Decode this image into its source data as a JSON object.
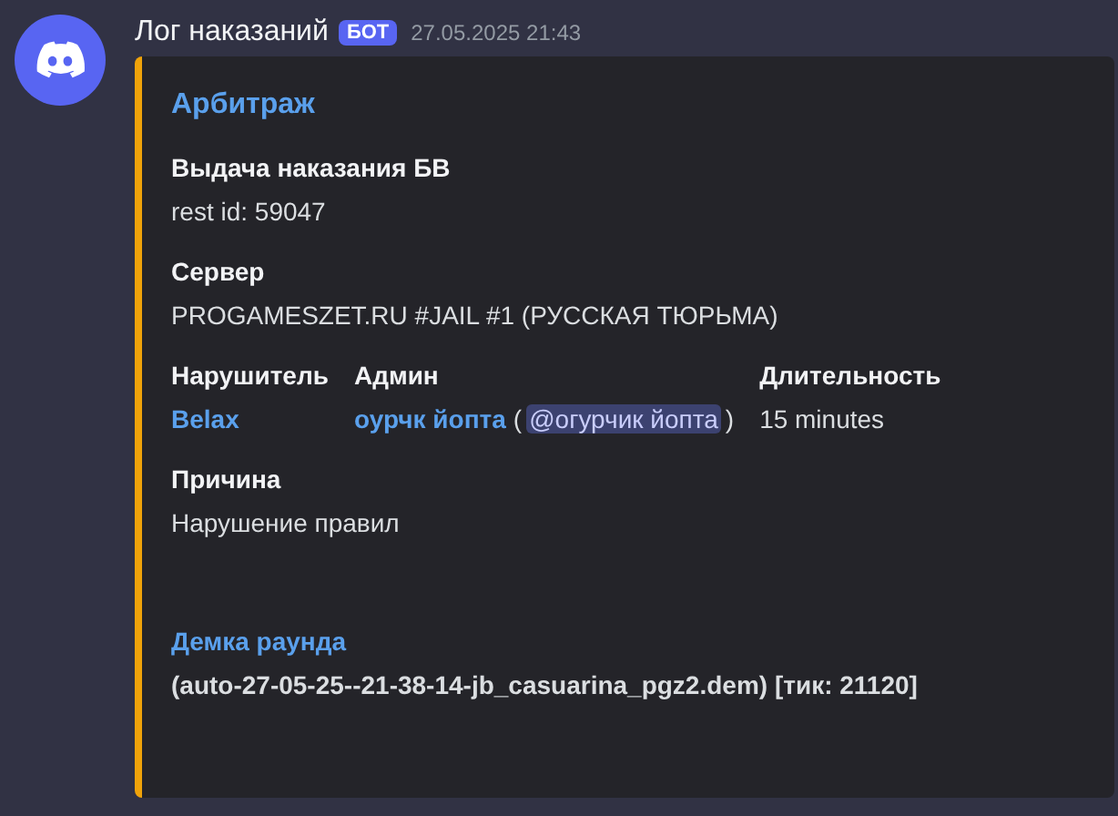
{
  "message": {
    "author": "Лог наказаний",
    "badge": "БОТ",
    "timestamp": "27.05.2025 21:43"
  },
  "embed": {
    "title": "Арбитраж",
    "fields": [
      {
        "name": "Выдача наказания БВ",
        "inline": false,
        "kind": "plain",
        "value": [
          {
            "kind": "text",
            "text": "rest id: 59047"
          }
        ]
      },
      {
        "name": "Сервер",
        "inline": false,
        "kind": "plain",
        "value": [
          {
            "kind": "text",
            "text": "PROGAMESZET.RU #JAIL #1 (РУССКАЯ ТЮРЬМА)"
          }
        ]
      },
      {
        "name": "Нарушитель",
        "inline": true,
        "kind": "plain",
        "value": [
          {
            "kind": "link",
            "text": "Belax"
          }
        ]
      },
      {
        "name": "Админ",
        "inline": true,
        "kind": "plain",
        "value": [
          {
            "kind": "link",
            "text": "оурчк йопта"
          },
          {
            "kind": "text",
            "text": "("
          },
          {
            "kind": "mention",
            "text": "@огурчик йопта"
          },
          {
            "kind": "text",
            "text": ")"
          }
        ]
      },
      {
        "name": "Длительность",
        "inline": true,
        "kind": "plain",
        "value": [
          {
            "kind": "text",
            "text": "15 minutes"
          }
        ]
      },
      {
        "name": "Причина",
        "inline": false,
        "kind": "plain",
        "value": [
          {
            "kind": "text",
            "text": "Нарушение правил"
          }
        ]
      },
      {
        "name": "Демка раунда",
        "inline": false,
        "kind": "highlight",
        "value": [
          {
            "kind": "text",
            "text": "(auto-27-05-25--21-38-14-jb_casuarina_pgz2.dem) [тик: 21120]"
          }
        ]
      }
    ]
  }
}
